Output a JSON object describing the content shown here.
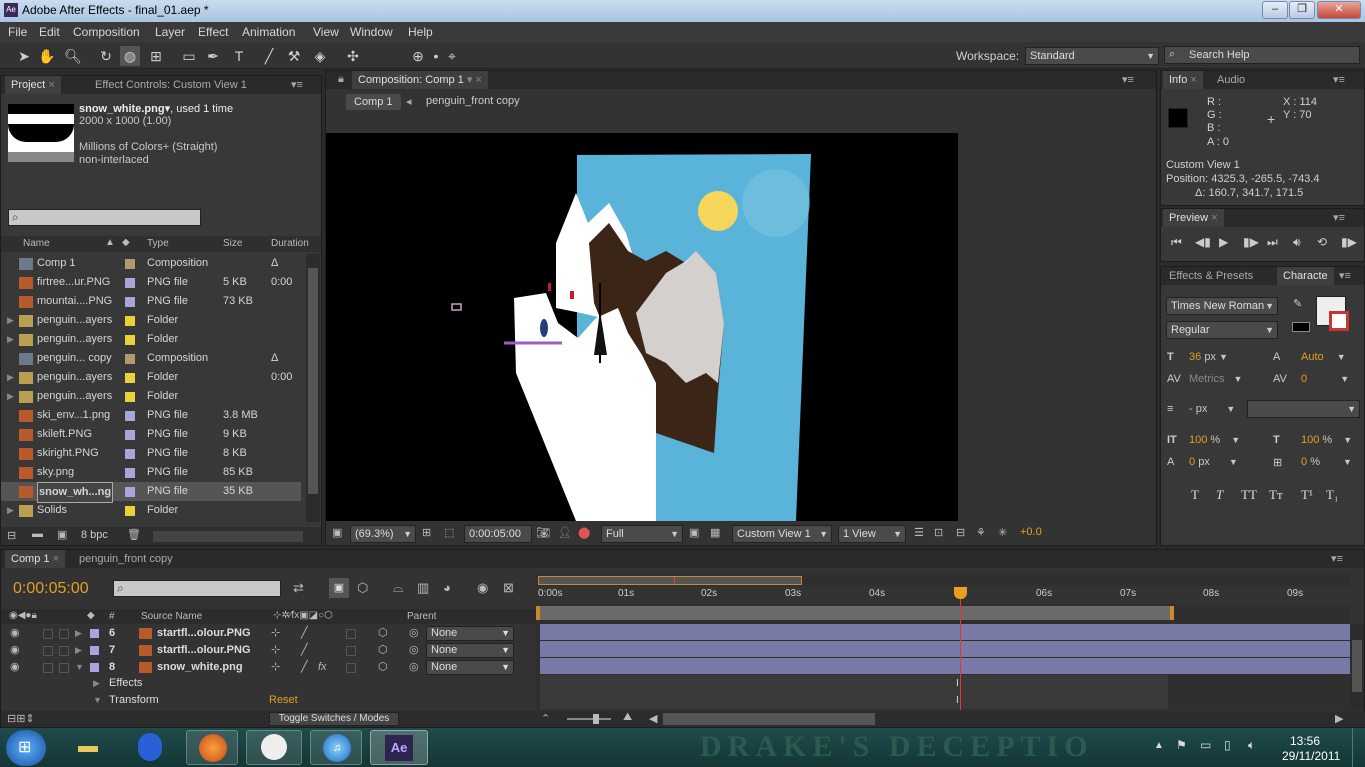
{
  "window": {
    "title": "Adobe After Effects - final_01.aep *",
    "app_icon": "Ae"
  },
  "menu": [
    "File",
    "Edit",
    "Composition",
    "Layer",
    "Effect",
    "Animation",
    "View",
    "Window",
    "Help"
  ],
  "toolbar": {
    "workspace_label": "Workspace:",
    "workspace_value": "Standard",
    "search_placeholder": "Search Help"
  },
  "project_panel": {
    "tabs": [
      "Project",
      "Effect Controls: Custom View 1"
    ],
    "selected_name": "snow_white.png",
    "used": ", used 1 time",
    "dims": "2000 x 1000 (1.00)",
    "colors": "Millions of Colors+ (Straight)",
    "interlace": "non-interlaced",
    "columns": [
      "Name",
      "Type",
      "Size",
      "Duration"
    ],
    "items": [
      {
        "name": "Comp 1",
        "type": "Composition",
        "size": "",
        "duration": "Δ 0:00",
        "label": "#b09a6c",
        "kind": "comp",
        "folder": false
      },
      {
        "name": "firtree...ur.PNG",
        "type": "PNG file",
        "size": "5 KB",
        "duration": "",
        "label": "#a6a6d8",
        "kind": "png",
        "folder": false
      },
      {
        "name": "mountai....PNG",
        "type": "PNG file",
        "size": "73 KB",
        "duration": "",
        "label": "#a6a6d8",
        "kind": "png",
        "folder": false
      },
      {
        "name": "penguin...ayers",
        "type": "Folder",
        "size": "",
        "duration": "",
        "label": "#e8d23a",
        "kind": "folder",
        "folder": true
      },
      {
        "name": "penguin...ayers",
        "type": "Folder",
        "size": "",
        "duration": "",
        "label": "#e8d23a",
        "kind": "folder",
        "folder": true
      },
      {
        "name": "penguin... copy",
        "type": "Composition",
        "size": "",
        "duration": "Δ 0:00",
        "label": "#b09a6c",
        "kind": "comp",
        "folder": false
      },
      {
        "name": "penguin...ayers",
        "type": "Folder",
        "size": "",
        "duration": "",
        "label": "#e8d23a",
        "kind": "folder",
        "folder": true
      },
      {
        "name": "penguin...ayers",
        "type": "Folder",
        "size": "",
        "duration": "",
        "label": "#e8d23a",
        "kind": "folder",
        "folder": true
      },
      {
        "name": "ski_env...1.png",
        "type": "PNG file",
        "size": "3.8 MB",
        "duration": "",
        "label": "#a6a6d8",
        "kind": "png",
        "folder": false
      },
      {
        "name": "skileft.PNG",
        "type": "PNG file",
        "size": "9 KB",
        "duration": "",
        "label": "#a6a6d8",
        "kind": "png",
        "folder": false
      },
      {
        "name": "skiright.PNG",
        "type": "PNG file",
        "size": "8 KB",
        "duration": "",
        "label": "#a6a6d8",
        "kind": "png",
        "folder": false
      },
      {
        "name": "sky.png",
        "type": "PNG file",
        "size": "85 KB",
        "duration": "",
        "label": "#a6a6d8",
        "kind": "png",
        "folder": false
      },
      {
        "name": "snow_wh...ng",
        "type": "PNG file",
        "size": "35 KB",
        "duration": "",
        "label": "#a6a6d8",
        "kind": "png",
        "folder": false
      },
      {
        "name": "Solids",
        "type": "Folder",
        "size": "",
        "duration": "",
        "label": "#e8d23a",
        "kind": "folder",
        "folder": true
      }
    ],
    "bpc": "8 bpc"
  },
  "comp_panel": {
    "tab": "Composition: Comp 1",
    "breadcrumb_active": "Comp 1",
    "breadcrumb_next": "penguin_front copy",
    "zoom": "(69.3%)",
    "time": "0:00:05:00",
    "resolution": "Full",
    "view": "Custom View 1",
    "views": "1 View",
    "exposure": "+0.0"
  },
  "info_panel": {
    "tabs": [
      "Info",
      "Audio"
    ],
    "r": "R :",
    "g": "G :",
    "b": "B :",
    "a": "A : 0",
    "x": "X : 114",
    "y": "Y : 70",
    "line1": "Custom View 1",
    "line2": "Position: 4325.3, -265.5, -743.4",
    "line3": "Δ: 160.7, 341.7, 171.5"
  },
  "preview_panel": {
    "tab": "Preview"
  },
  "character_panel": {
    "tabs": [
      "Effects & Presets",
      "Characte"
    ],
    "font": "Times New Roman",
    "style": "Regular",
    "size": "36",
    "size_unit": "px",
    "leading": "Auto",
    "kerning": "Metrics",
    "tracking": "0",
    "stroke_unit": "px",
    "vscale": "100",
    "hscale": "100",
    "baseline": "0",
    "baseline_unit": "px",
    "tsume": "0",
    "percent": "%",
    "style_buttons": [
      "T",
      "T",
      "TT",
      "Tт",
      "T¹",
      "T₁"
    ]
  },
  "timeline": {
    "tabs": [
      "Comp 1",
      "penguin_front copy"
    ],
    "timecode": "0:00:05:00",
    "col_num": "#",
    "col_source": "Source Name",
    "col_parent": "Parent",
    "ruler": [
      "0:00s",
      "01s",
      "02s",
      "03s",
      "04s",
      "06s",
      "07s",
      "08s",
      "09s"
    ],
    "layers": [
      {
        "num": "6",
        "name": "startfl...olour.PNG",
        "parent": "None",
        "expanded": false,
        "fx": false
      },
      {
        "num": "7",
        "name": "startfl...olour.PNG",
        "parent": "None",
        "expanded": false,
        "fx": false
      },
      {
        "num": "8",
        "name": "snow_white.png",
        "parent": "None",
        "expanded": true,
        "fx": true
      }
    ],
    "effects_label": "Effects",
    "transform_label": "Transform",
    "reset_label": "Reset",
    "toggle_label": "Toggle Switches / Modes"
  },
  "taskbar": {
    "time": "13:56",
    "date": "29/11/2011",
    "watermark": "DRAKE'S DECEPTIO",
    "ae_label": "Ae"
  }
}
